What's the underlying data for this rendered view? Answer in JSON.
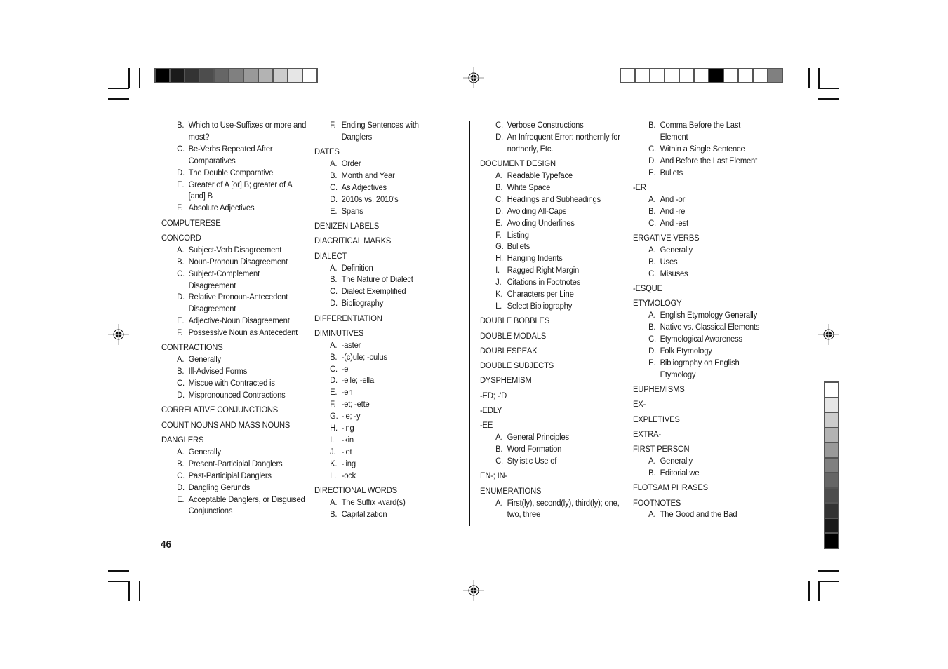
{
  "page_number": "46",
  "color_bars": {
    "top_left": [
      "#000000",
      "#1a1a1a",
      "#333333",
      "#4d4d4d",
      "#666666",
      "#808080",
      "#999999",
      "#b3b3b3",
      "#cccccc",
      "#e6e6e6",
      "#ffffff"
    ],
    "top_right": [
      "#ffffff",
      "#ffffff",
      "#ffffff",
      "#ffffff",
      "#ffffff",
      "#ffffff",
      "#000000",
      "#ffffff",
      "#ffffff",
      "#ffffff",
      "#808080"
    ],
    "right_side": [
      "#ffffff",
      "#e6e6e6",
      "#cccccc",
      "#b3b3b3",
      "#999999",
      "#808080",
      "#666666",
      "#4d4d4d",
      "#333333",
      "#1a1a1a",
      "#000000"
    ]
  },
  "columns": [
    {
      "entries": [
        {
          "heading": "",
          "items": [
            {
              "letter": "B.",
              "text": "Which to Use-Suffixes or more and most?"
            },
            {
              "letter": "C.",
              "text": "Be-Verbs Repeated After Comparatives"
            },
            {
              "letter": "D.",
              "text": "The Double Comparative"
            },
            {
              "letter": "E.",
              "text": "Greater of A [or] B; greater of A [and] B"
            },
            {
              "letter": "F.",
              "text": "Absolute Adjectives"
            }
          ]
        },
        {
          "heading": "COMPUTERESE",
          "items": []
        },
        {
          "heading": "CONCORD",
          "items": [
            {
              "letter": "A.",
              "text": "Subject-Verb Disagreement"
            },
            {
              "letter": "B.",
              "text": "Noun-Pronoun Disagreement"
            },
            {
              "letter": "C.",
              "text": "Subject-Complement Disagreement"
            },
            {
              "letter": "D.",
              "text": "Relative Pronoun-Antecedent Disagreement"
            },
            {
              "letter": "E.",
              "text": "Adjective-Noun Disagreement"
            },
            {
              "letter": "F.",
              "text": "Possessive Noun as Antecedent"
            }
          ]
        },
        {
          "heading": "CONTRACTIONS",
          "items": [
            {
              "letter": "A.",
              "text": "Generally"
            },
            {
              "letter": "B.",
              "text": "Ill-Advised Forms"
            },
            {
              "letter": "C.",
              "text": "Miscue with Contracted is"
            },
            {
              "letter": "D.",
              "text": "Mispronounced Contractions"
            }
          ]
        },
        {
          "heading": "CORRELATIVE CONJUNCTIONS",
          "items": []
        },
        {
          "heading": "COUNT NOUNS AND MASS NOUNS",
          "items": []
        },
        {
          "heading": "DANGLERS",
          "items": [
            {
              "letter": "A.",
              "text": "Generally"
            },
            {
              "letter": "B.",
              "text": "Present-Participial Danglers"
            },
            {
              "letter": "C.",
              "text": "Past-Participial Danglers"
            },
            {
              "letter": "D.",
              "text": "Dangling Gerunds"
            },
            {
              "letter": "E.",
              "text": "Acceptable Danglers, or Disguised Conjunctions"
            }
          ]
        }
      ]
    },
    {
      "entries": [
        {
          "heading": "",
          "items": [
            {
              "letter": "F.",
              "text": "Ending Sentences with Danglers"
            }
          ]
        },
        {
          "heading": "DATES",
          "items": [
            {
              "letter": "A.",
              "text": "Order"
            },
            {
              "letter": "B.",
              "text": "Month and Year"
            },
            {
              "letter": "C.",
              "text": "As Adjectives"
            },
            {
              "letter": "D.",
              "text": "2010s vs. 2010's"
            },
            {
              "letter": "E.",
              "text": "Spans"
            }
          ]
        },
        {
          "heading": "DENIZEN LABELS",
          "items": []
        },
        {
          "heading": "DIACRITICAL MARKS",
          "items": []
        },
        {
          "heading": "DIALECT",
          "items": [
            {
              "letter": "A.",
              "text": "Definition"
            },
            {
              "letter": "B.",
              "text": "The Nature of Dialect"
            },
            {
              "letter": "C.",
              "text": "Dialect Exemplified"
            },
            {
              "letter": "D.",
              "text": "Bibliography"
            }
          ]
        },
        {
          "heading": "DIFFERENTIATION",
          "items": []
        },
        {
          "heading": "DIMINUTIVES",
          "items": [
            {
              "letter": "A.",
              "text": "-aster"
            },
            {
              "letter": "B.",
              "text": "-(c)ule; -culus"
            },
            {
              "letter": "C.",
              "text": "-el"
            },
            {
              "letter": "D.",
              "text": "-elle; -ella"
            },
            {
              "letter": "E.",
              "text": "-en"
            },
            {
              "letter": "F.",
              "text": "-et; -ette"
            },
            {
              "letter": "G.",
              "text": "-ie; -y"
            },
            {
              "letter": "H.",
              "text": "-ing"
            },
            {
              "letter": "I.",
              "text": "-kin"
            },
            {
              "letter": "J.",
              "text": "-let"
            },
            {
              "letter": "K.",
              "text": "-ling"
            },
            {
              "letter": "L.",
              "text": "-ock"
            }
          ]
        },
        {
          "heading": "DIRECTIONAL WORDS",
          "items": [
            {
              "letter": "A.",
              "text": "The Suffix -ward(s)"
            },
            {
              "letter": "B.",
              "text": "Capitalization"
            }
          ]
        }
      ]
    },
    {
      "entries": [
        {
          "heading": "",
          "items": [
            {
              "letter": "C.",
              "text": "Verbose Constructions"
            },
            {
              "letter": "D.",
              "text": "An Infrequent Error: northernly for northerly, Etc."
            }
          ]
        },
        {
          "heading": "DOCUMENT DESIGN",
          "items": [
            {
              "letter": "A.",
              "text": "Readable Typeface"
            },
            {
              "letter": "B.",
              "text": "White Space"
            },
            {
              "letter": "C.",
              "text": "Headings and Subheadings"
            },
            {
              "letter": "D.",
              "text": "Avoiding All-Caps"
            },
            {
              "letter": "E.",
              "text": "Avoiding Underlines"
            },
            {
              "letter": "F.",
              "text": "Listing"
            },
            {
              "letter": "G.",
              "text": "Bullets"
            },
            {
              "letter": "H.",
              "text": "Hanging Indents"
            },
            {
              "letter": "I.",
              "text": "Ragged Right Margin"
            },
            {
              "letter": "J.",
              "text": "Citations in Footnotes"
            },
            {
              "letter": "K.",
              "text": "Characters per Line"
            },
            {
              "letter": "L.",
              "text": "Select Bibliography"
            }
          ]
        },
        {
          "heading": "DOUBLE BOBBLES",
          "items": []
        },
        {
          "heading": "DOUBLE MODALS",
          "items": []
        },
        {
          "heading": "DOUBLESPEAK",
          "items": []
        },
        {
          "heading": "DOUBLE SUBJECTS",
          "items": []
        },
        {
          "heading": "DYSPHEMISM",
          "items": []
        },
        {
          "heading": "-ED; -'D",
          "items": []
        },
        {
          "heading": "-EDLY",
          "items": []
        },
        {
          "heading": "-EE",
          "items": [
            {
              "letter": "A.",
              "text": "General Principles"
            },
            {
              "letter": "B.",
              "text": "Word Formation"
            },
            {
              "letter": "C.",
              "text": "Stylistic Use of"
            }
          ]
        },
        {
          "heading": "EN-; IN-",
          "items": []
        },
        {
          "heading": "ENUMERATIONS",
          "items": [
            {
              "letter": "A.",
              "text": "First(ly), second(ly), third(ly); one, two, three"
            }
          ]
        }
      ]
    },
    {
      "entries": [
        {
          "heading": "",
          "items": [
            {
              "letter": "B.",
              "text": "Comma Before the Last Element"
            },
            {
              "letter": "C.",
              "text": "Within a Single Sentence"
            },
            {
              "letter": "D.",
              "text": "And Before the Last Element"
            },
            {
              "letter": "E.",
              "text": "Bullets"
            }
          ]
        },
        {
          "heading": "-ER",
          "items": [
            {
              "letter": "A.",
              "text": "And -or"
            },
            {
              "letter": "B.",
              "text": "And -re"
            },
            {
              "letter": "C.",
              "text": "And -est"
            }
          ]
        },
        {
          "heading": "ERGATIVE VERBS",
          "items": [
            {
              "letter": "A.",
              "text": "Generally"
            },
            {
              "letter": "B.",
              "text": "Uses"
            },
            {
              "letter": "C.",
              "text": "Misuses"
            }
          ]
        },
        {
          "heading": "-ESQUE",
          "items": []
        },
        {
          "heading": "ETYMOLOGY",
          "items": [
            {
              "letter": "A.",
              "text": "English Etymology Generally"
            },
            {
              "letter": "B.",
              "text": "Native vs. Classical Elements"
            },
            {
              "letter": "C.",
              "text": "Etymological Awareness"
            },
            {
              "letter": "D.",
              "text": "Folk Etymology"
            },
            {
              "letter": "E.",
              "text": "Bibliography on English Etymology"
            }
          ]
        },
        {
          "heading": "EUPHEMISMS",
          "items": []
        },
        {
          "heading": "EX-",
          "items": []
        },
        {
          "heading": "EXPLETIVES",
          "items": []
        },
        {
          "heading": "EXTRA-",
          "items": []
        },
        {
          "heading": "FIRST PERSON",
          "items": [
            {
              "letter": "A.",
              "text": "Generally"
            },
            {
              "letter": "B.",
              "text": "Editorial we"
            }
          ]
        },
        {
          "heading": "FLOTSAM PHRASES",
          "items": []
        },
        {
          "heading": "FOOTNOTES",
          "items": [
            {
              "letter": "A.",
              "text": "The Good and the Bad"
            }
          ]
        }
      ]
    }
  ]
}
